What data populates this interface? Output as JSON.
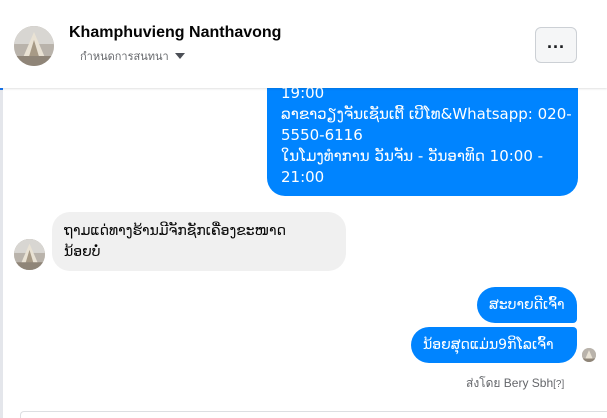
{
  "header": {
    "contact_name": "Khamphuvieng Nanthavong",
    "status_text": "กำหนดการสนทนา",
    "menu_label": "..."
  },
  "messages": {
    "outgoing_info": {
      "lines": [
        "19:00",
        "ລາຂາວຽງຈັນເຊັນເຕີ້ ເບີໂທ&Whatsapp: 020-",
        "5550-6116",
        "ໃນໂມງທຳການ ວັນຈັນ - ວັນອາທິດ  10:00 -",
        "21:00"
      ]
    },
    "incoming_question": {
      "lines": [
        "ຖາມແດ່ທາງຮ້ານມີຈັກຊັກເຄື່ອງຂະໜາດ",
        "ນ້ອຍບໍ່"
      ]
    },
    "reply_1": "ສະບາຍດີເຈົ້າ",
    "reply_2": "ນ້ອຍສຸດແມ່ນ9ກິໂລເຈົ້າ"
  },
  "sent_by": {
    "prefix": "ส่งโดย",
    "name": "Bery Sbh",
    "help": "[?]"
  },
  "colors": {
    "outgoing_bubble": "#0084ff",
    "incoming_bubble": "#f0f0f0",
    "accent": "#1877f2"
  },
  "icons": {
    "status_caret": "caret-down-icon",
    "menu": "more-dots-icon"
  }
}
